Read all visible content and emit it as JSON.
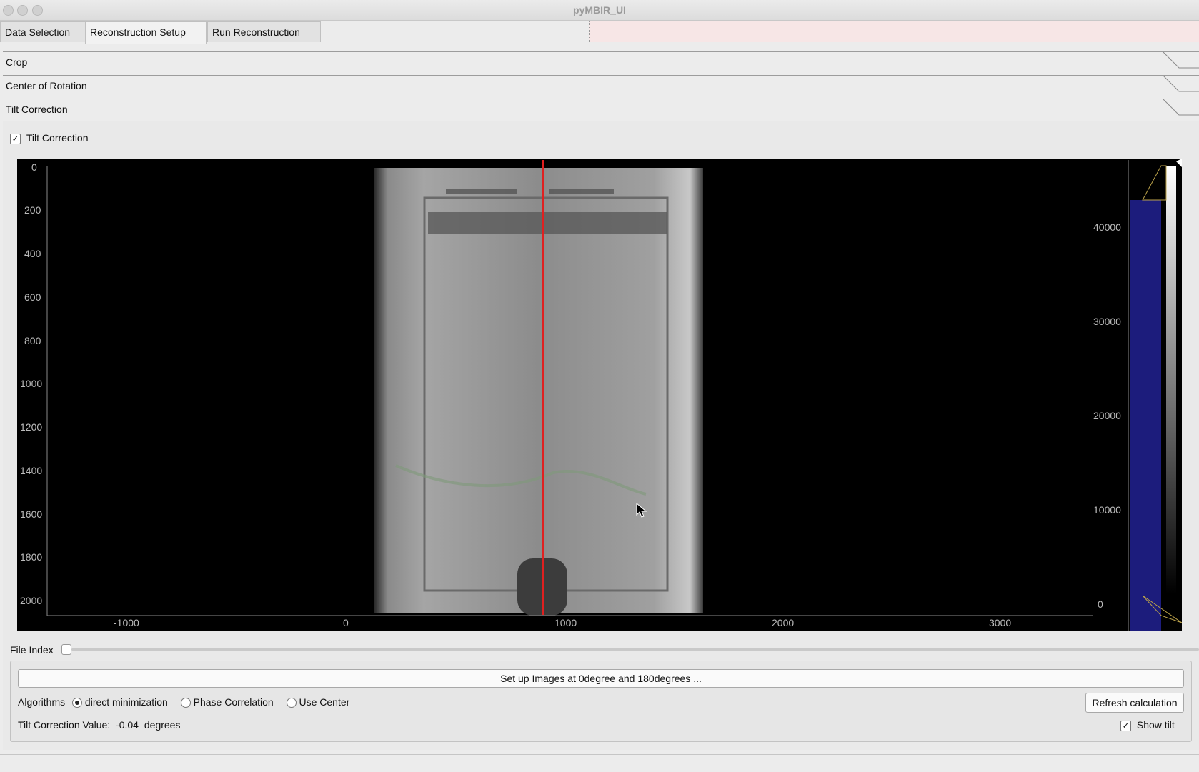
{
  "window": {
    "title": "pyMBIR_UI"
  },
  "tabs": [
    {
      "label": "Data Selection"
    },
    {
      "label": "Reconstruction Setup"
    },
    {
      "label": "Run Reconstruction"
    }
  ],
  "sections": {
    "crop": "Crop",
    "center_of_rotation": "Center of Rotation",
    "tilt_correction": "Tilt Correction"
  },
  "tilt_panel": {
    "checkbox_label": "Tilt Correction",
    "checkbox_checked": true,
    "file_index_label": "File Index",
    "setup_button": "Set up Images at 0degree and 180degrees ...",
    "algorithms_label": "Algorithms",
    "algorithm_options": [
      "direct minimization",
      "Phase Correlation",
      "Use Center"
    ],
    "algorithm_selected": "direct minimization",
    "refresh_button": "Refresh calculation",
    "tilt_value_label": "Tilt Correction Value:",
    "tilt_value": "-0.04",
    "tilt_unit": "degrees",
    "show_tilt_label": "Show tilt",
    "show_tilt_checked": true
  },
  "image_view": {
    "y_ticks": [
      "0",
      "200",
      "400",
      "600",
      "800",
      "1000",
      "1200",
      "1400",
      "1600",
      "1800",
      "2000"
    ],
    "x_ticks": [
      "-1000",
      "0",
      "1000",
      "2000",
      "3000"
    ],
    "histogram_ticks": [
      "40000",
      "30000",
      "20000",
      "10000",
      "0"
    ],
    "line_color": "#e02020",
    "histogram_color": "#1f1f8a"
  },
  "colors": {
    "window_bg": "#ececec",
    "plot_bg": "#000000",
    "error_strip": "#f7e6e6"
  }
}
